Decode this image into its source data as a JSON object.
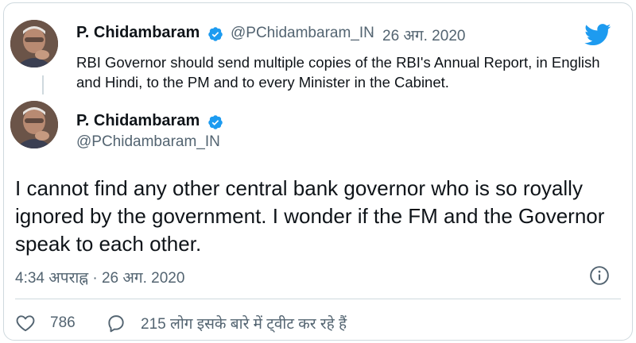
{
  "quoted_tweet": {
    "author_name": "P. Chidambaram",
    "handle": "@PChidambaram_IN",
    "separator": "·",
    "date": "26 अग. 2020",
    "text": "RBI Governor should send multiple copies of the RBI's Annual Report, in English and Hindi, to the PM and to every Minister in the Cabinet."
  },
  "tweet": {
    "author_name": "P. Chidambaram",
    "handle": "@PChidambaram_IN",
    "text": "I cannot find any other central bank governor who is so royally ignored by the government. I wonder if the FM and the Governor speak to each other.",
    "timestamp": "4:34 अपराह्न · 26 अग. 2020"
  },
  "actions": {
    "likes_count": "786",
    "replies_label": "215 लोग इसके बारे में ट्वीट कर रहे हैं"
  },
  "icons": {
    "verified": "verified-badge-icon",
    "brand": "twitter-bird-icon",
    "info": "info-icon",
    "like": "heart-icon",
    "reply": "speech-bubble-icon"
  },
  "colors": {
    "brand_blue": "#1d9bf0",
    "text": "#0f1419",
    "secondary_text": "#536471",
    "border": "#cfd9de"
  }
}
